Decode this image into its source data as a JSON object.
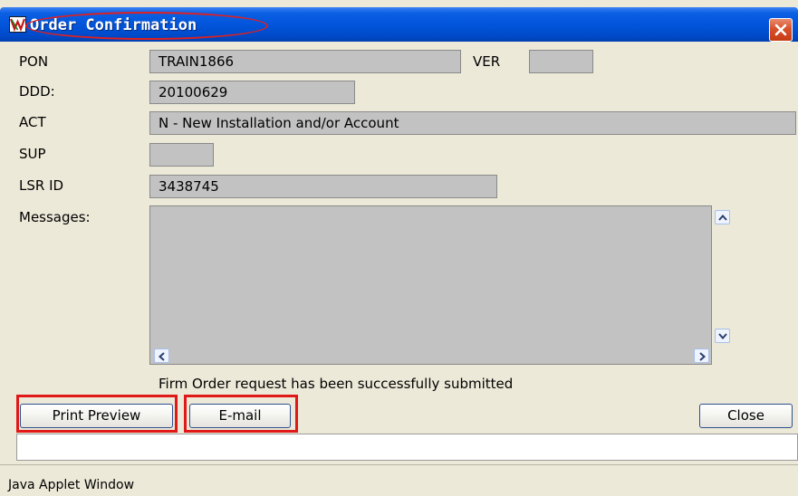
{
  "window": {
    "title": "Order Confirmation"
  },
  "form": {
    "pon_label": "PON",
    "pon_value": "TRAIN1866",
    "ver_label": "VER",
    "ver_value": "",
    "ddd_label": "DDD:",
    "ddd_value": "20100629",
    "act_label": "ACT",
    "act_value": "N - New Installation and/or Account",
    "sup_label": "SUP",
    "sup_value": "",
    "lsr_label": "LSR ID",
    "lsr_value": "3438745",
    "messages_label": "Messages:",
    "messages_value": ""
  },
  "status": {
    "message": "Firm Order request has been successfully submitted"
  },
  "buttons": {
    "print_preview": "Print Preview",
    "email": "E-mail",
    "close": "Close"
  },
  "footer": {
    "applet_text": "Java Applet Window"
  },
  "icons": {
    "app": "applet-logo-icon",
    "close": "close-x-icon",
    "scroll_up": "arrow-up-icon",
    "scroll_down": "arrow-down-icon",
    "scroll_left": "arrow-left-icon",
    "scroll_right": "arrow-right-icon"
  },
  "colors": {
    "titlebar": "#0154d9",
    "field_bg": "#c2c2c2",
    "window_bg": "#ece9d8",
    "highlight": "#e01818"
  }
}
